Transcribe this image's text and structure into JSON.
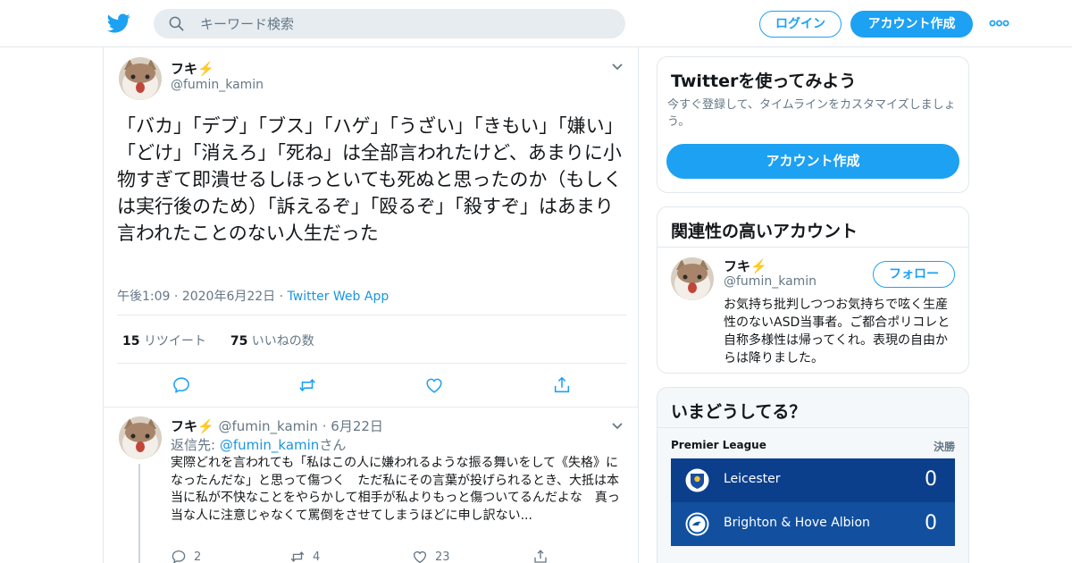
{
  "header": {
    "search_placeholder": "キーワード検索",
    "login_label": "ログイン",
    "signup_label": "アカウント作成",
    "brand_color": "#1da1f2"
  },
  "tweet": {
    "name": "フキ⚡️",
    "handle": "@fumin_kamin",
    "text": "「バカ」「デブ」「ブス」「ハゲ」「うざい」「きもい」「嫌い」「どけ」「消えろ」「死ね」は全部言われたけど、あまりに小物すぎて即潰せるしほっといても死ぬと思ったのか（もしくは実行後のため）「訴えるぞ」「殴るぞ」「殺すぞ」はあまり言われたことのない人生だった",
    "time": "午後1:09",
    "date": "2020年6月22日",
    "source": "Twitter Web App",
    "retweet_count": "15",
    "retweet_label": "リツイート",
    "like_count": "75",
    "like_label": "いいねの数"
  },
  "reply": {
    "name": "フキ⚡️",
    "handle": "@fumin_kamin",
    "date": "6月22日",
    "reply_to_prefix": "返信先: ",
    "reply_to_handle": "@fumin_kamin",
    "reply_to_suffix": "さん",
    "text": "実際どれを言われても「私はこの人に嫌われるような振る舞いをして《失格》になったんだな」と思って傷つく　ただ私にその言葉が投げられるとき、大抵は本当に私が不快なことをやらかして相手が私よりもっと傷ついてるんだよな　真っ当な人に注意じゃなくて罵倒をさせてしまうほどに申し訳ない...",
    "reply_count": "2",
    "retweet_count": "4",
    "like_count": "23"
  },
  "sidebar": {
    "signup_card": {
      "title": "Twitterを使ってみよう",
      "description": "今すぐ登録して、タイムラインをカスタマイズしましょう。",
      "button_label": "アカウント作成"
    },
    "related_card": {
      "title": "関連性の高いアカウント",
      "name": "フキ⚡️",
      "handle": "@fumin_kamin",
      "follow_label": "フォロー",
      "bio": "お気持ち批判しつつお気持ちで呟く生産性のないASD当事者。ご都合ポリコレと自称多様性は帰ってくれ。表現の自由からは降りました。"
    },
    "trends_card": {
      "title": "いまどうしてる？",
      "league": "Premier League",
      "status": "決勝",
      "teams": [
        {
          "name": "Leicester",
          "score": "0",
          "crest_color": "#1a4ea0"
        },
        {
          "name": "Brighton & Hove Albion",
          "score": "0",
          "crest_color": "#0054a6"
        }
      ]
    }
  }
}
